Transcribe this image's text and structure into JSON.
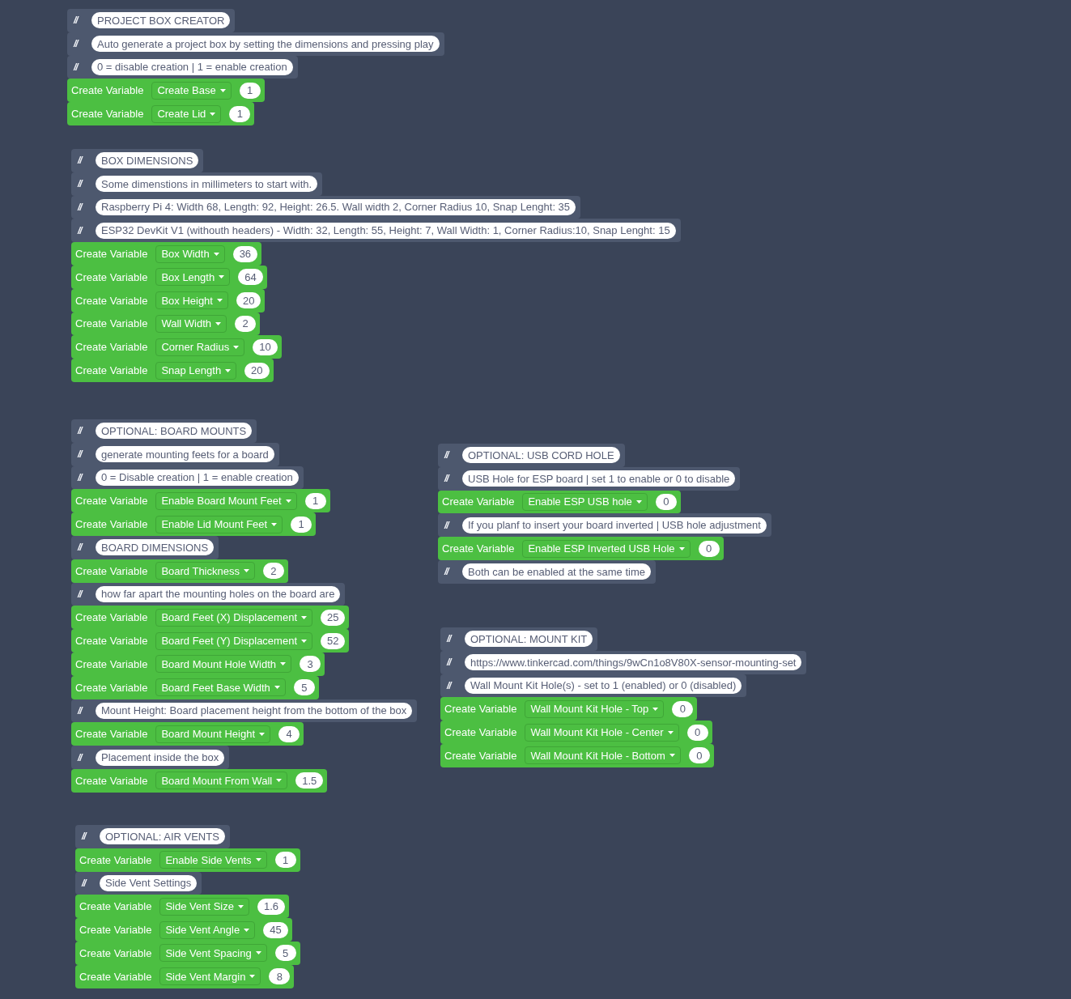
{
  "stacks": [
    {
      "blocks": [
        {
          "kind": "comment",
          "marker": "//",
          "text": "PROJECT BOX CREATOR"
        },
        {
          "kind": "comment",
          "marker": "//",
          "text": "Auto generate a project box by setting the dimensions and pressing play"
        },
        {
          "kind": "comment",
          "marker": "//",
          "text": "0 = disable creation | 1 = enable creation"
        },
        {
          "kind": "variable",
          "label": "Create Variable",
          "name": "Create Base",
          "value": "1"
        },
        {
          "kind": "variable",
          "label": "Create Variable",
          "name": "Create Lid",
          "value": "1"
        }
      ]
    },
    {
      "blocks": [
        {
          "kind": "comment",
          "marker": "//",
          "text": "BOX DIMENSIONS"
        },
        {
          "kind": "comment",
          "marker": "//",
          "text": "Some dimenstions in millimeters to start with."
        },
        {
          "kind": "comment",
          "marker": "//",
          "text": "Raspberry Pi 4: Width 68, Length: 92, Height: 26.5. Wall width 2, Corner Radius 10, Snap Lenght: 35"
        },
        {
          "kind": "comment",
          "marker": "//",
          "text": "ESP32 DevKit V1 (withouth headers) - Width: 32, Length: 55, Height: 7, Wall Width: 1, Corner Radius:10, Snap Lenght: 15"
        },
        {
          "kind": "variable",
          "label": "Create Variable",
          "name": "Box Width",
          "value": "36"
        },
        {
          "kind": "variable",
          "label": "Create Variable",
          "name": "Box Length",
          "value": "64"
        },
        {
          "kind": "variable",
          "label": "Create Variable",
          "name": "Box Height",
          "value": "20"
        },
        {
          "kind": "variable",
          "label": "Create Variable",
          "name": "Wall Width",
          "value": "2"
        },
        {
          "kind": "variable",
          "label": "Create Variable",
          "name": "Corner Radius",
          "value": "10"
        },
        {
          "kind": "variable",
          "label": "Create Variable",
          "name": "Snap Length",
          "value": "20"
        }
      ]
    },
    {
      "blocks": [
        {
          "kind": "comment",
          "marker": "//",
          "text": "OPTIONAL: BOARD MOUNTS"
        },
        {
          "kind": "comment",
          "marker": "//",
          "text": "generate mounting feets for a board"
        },
        {
          "kind": "comment",
          "marker": "//",
          "text": "0 = Disable creation | 1 = enable creation"
        },
        {
          "kind": "variable",
          "label": "Create Variable",
          "name": "Enable Board Mount Feet",
          "value": "1"
        },
        {
          "kind": "variable",
          "label": "Create Variable",
          "name": "Enable Lid Mount Feet",
          "value": "1"
        },
        {
          "kind": "comment",
          "marker": "//",
          "text": "BOARD DIMENSIONS"
        },
        {
          "kind": "variable",
          "label": "Create Variable",
          "name": "Board Thickness",
          "value": "2"
        },
        {
          "kind": "comment",
          "marker": "//",
          "text": "how far apart the mounting holes on the board are"
        },
        {
          "kind": "variable",
          "label": "Create Variable",
          "name": "Board Feet (X) Displacement",
          "value": "25"
        },
        {
          "kind": "variable",
          "label": "Create Variable",
          "name": "Board Feet (Y) Displacement",
          "value": "52"
        },
        {
          "kind": "variable",
          "label": "Create Variable",
          "name": "Board Mount Hole Width",
          "value": "3"
        },
        {
          "kind": "variable",
          "label": "Create Variable",
          "name": "Board Feet Base Width",
          "value": "5"
        },
        {
          "kind": "comment",
          "marker": "//",
          "text": "Mount Height: Board placement height from the bottom of the box"
        },
        {
          "kind": "variable",
          "label": "Create Variable",
          "name": "Board Mount Height",
          "value": "4"
        },
        {
          "kind": "comment",
          "marker": "//",
          "text": "Placement inside the box"
        },
        {
          "kind": "variable",
          "label": "Create Variable",
          "name": "Board Mount From Wall",
          "value": "1.5"
        }
      ]
    },
    {
      "blocks": [
        {
          "kind": "comment",
          "marker": "//",
          "text": "OPTIONAL: USB CORD HOLE"
        },
        {
          "kind": "comment",
          "marker": "//",
          "text": "USB Hole for ESP board | set 1 to enable or 0 to disable"
        },
        {
          "kind": "variable",
          "label": "Create Variable",
          "name": "Enable ESP USB hole",
          "value": "0"
        },
        {
          "kind": "comment",
          "marker": "//",
          "text": "If you planf to insert your board inverted | USB hole adjustment"
        },
        {
          "kind": "variable",
          "label": "Create Variable",
          "name": "Enable ESP Inverted USB Hole",
          "value": "0"
        },
        {
          "kind": "comment",
          "marker": "//",
          "text": "Both can be enabled at the same time"
        }
      ]
    },
    {
      "blocks": [
        {
          "kind": "comment",
          "marker": "//",
          "text": "OPTIONAL: MOUNT KIT"
        },
        {
          "kind": "comment",
          "marker": "//",
          "text": "https://www.tinkercad.com/things/9wCn1o8V80X-sensor-mounting-set"
        },
        {
          "kind": "comment",
          "marker": "//",
          "text": "Wall Mount Kit Hole(s) - set to 1 (enabled) or 0 (disabled)"
        },
        {
          "kind": "variable",
          "label": "Create Variable",
          "name": "Wall Mount Kit Hole - Top",
          "value": "0"
        },
        {
          "kind": "variable",
          "label": "Create Variable",
          "name": "Wall Mount Kit Hole - Center",
          "value": "0"
        },
        {
          "kind": "variable",
          "label": "Create Variable",
          "name": "Wall Mount Kit Hole - Bottom",
          "value": "0"
        }
      ]
    },
    {
      "blocks": [
        {
          "kind": "comment",
          "marker": "//",
          "text": "OPTIONAL: AIR VENTS"
        },
        {
          "kind": "variable",
          "label": "Create Variable",
          "name": "Enable Side Vents",
          "value": "1"
        },
        {
          "kind": "comment",
          "marker": "//",
          "text": "Side Vent Settings"
        },
        {
          "kind": "variable",
          "label": "Create Variable",
          "name": "Side Vent Size",
          "value": "1.6"
        },
        {
          "kind": "variable",
          "label": "Create Variable",
          "name": "Side Vent Angle",
          "value": "45"
        },
        {
          "kind": "variable",
          "label": "Create Variable",
          "name": "Side Vent Spacing",
          "value": "5"
        },
        {
          "kind": "variable",
          "label": "Create Variable",
          "name": "Side Vent Margin",
          "value": "8"
        }
      ]
    }
  ]
}
